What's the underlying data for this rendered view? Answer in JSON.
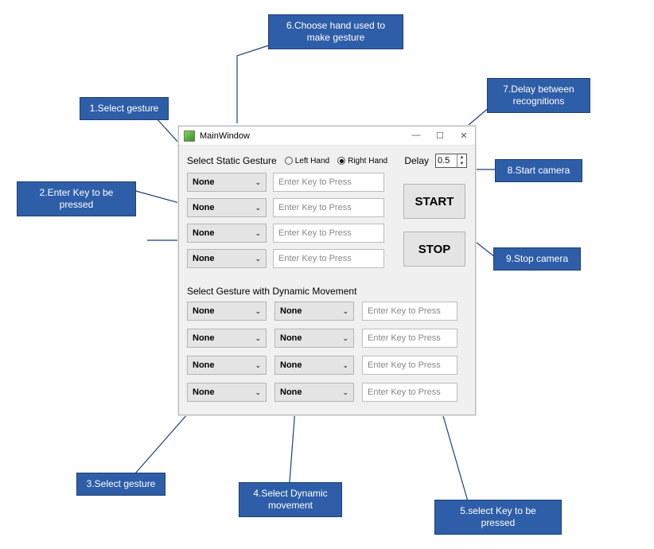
{
  "window": {
    "title": "MainWindow"
  },
  "static": {
    "heading": "Select Static Gesture",
    "leftHand": "Left Hand",
    "rightHand": "Right Hand",
    "delayLabel": "Delay",
    "delayValue": "0.5",
    "rows": [
      {
        "combo": "None",
        "placeholder": "Enter Key to Press"
      },
      {
        "combo": "None",
        "placeholder": "Enter Key to Press"
      },
      {
        "combo": "None",
        "placeholder": "Enter Key to Press"
      },
      {
        "combo": "None",
        "placeholder": "Enter Key to Press"
      }
    ],
    "startLabel": "START",
    "stopLabel": "STOP"
  },
  "dynamic": {
    "heading": "Select Gesture with Dynamic Movement",
    "rows": [
      {
        "combo1": "None",
        "combo2": "None",
        "placeholder": "Enter Key to Press"
      },
      {
        "combo1": "None",
        "combo2": "None",
        "placeholder": "Enter Key to Press"
      },
      {
        "combo1": "None",
        "combo2": "None",
        "placeholder": "Enter Key to Press"
      },
      {
        "combo1": "None",
        "combo2": "None",
        "placeholder": "Enter Key to Press"
      }
    ]
  },
  "callouts": {
    "c1": "1.Select gesture",
    "c2": "2.Enter Key to be pressed",
    "c3": "3.Select gesture",
    "c4": "4.Select Dynamic movement",
    "c5": "5.select Key to be pressed",
    "c6": "6.Choose hand  used to make gesture",
    "c7": "7.Delay between recognitions",
    "c8": "8.Start camera",
    "c9": "9.Stop camera"
  }
}
